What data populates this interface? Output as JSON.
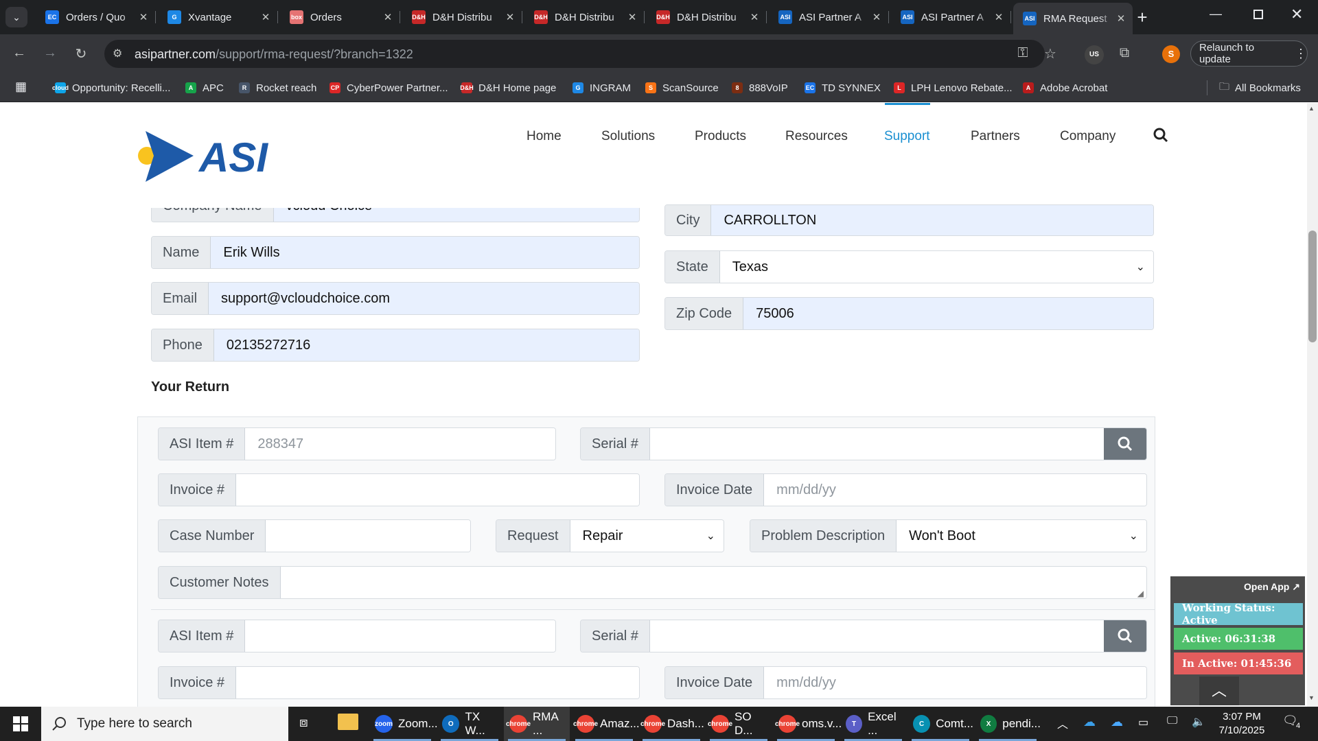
{
  "browser": {
    "tabs": [
      {
        "title": "Orders / Quo",
        "favicon": "EC",
        "color": "#1a73e8"
      },
      {
        "title": "Xvantage",
        "favicon": "G",
        "color": "#1e88e5"
      },
      {
        "title": "Orders",
        "favicon": "box",
        "color": "#e57373"
      },
      {
        "title": "D&H Distribu",
        "favicon": "D&H",
        "color": "#c62828"
      },
      {
        "title": "D&H Distribu",
        "favicon": "D&H",
        "color": "#c62828"
      },
      {
        "title": "D&H Distribu",
        "favicon": "D&H",
        "color": "#c62828"
      },
      {
        "title": "ASI Partner A",
        "favicon": "ASI",
        "color": "#1565c0"
      },
      {
        "title": "ASI Partner A",
        "favicon": "ASI",
        "color": "#1565c0"
      },
      {
        "title": "RMA Request",
        "favicon": "ASI",
        "color": "#1565c0",
        "active": true
      }
    ],
    "url_domain": "asipartner.com",
    "url_path": "/support/rma-request/?branch=1322",
    "relaunch_label": "Relaunch to update",
    "profile_initial": "S",
    "bookmarks": [
      {
        "label": "Opportunity: Recelli...",
        "icon": "cloud",
        "color": "#0ea5e9"
      },
      {
        "label": "APC",
        "icon": "A",
        "color": "#16a34a"
      },
      {
        "label": "Rocket reach",
        "icon": "R",
        "color": "#475569"
      },
      {
        "label": "CyberPower Partner...",
        "icon": "CP",
        "color": "#dc2626"
      },
      {
        "label": "D&H Home page",
        "icon": "D&H",
        "color": "#c62828"
      },
      {
        "label": "INGRAM",
        "icon": "G",
        "color": "#1e88e5"
      },
      {
        "label": "ScanSource",
        "icon": "S",
        "color": "#f97316"
      },
      {
        "label": "888VoIP",
        "icon": "8",
        "color": "#7c2d12"
      },
      {
        "label": "TD SYNNEX",
        "icon": "EC",
        "color": "#1a73e8"
      },
      {
        "label": "LPH Lenovo Rebate...",
        "icon": "L",
        "color": "#dc2626"
      },
      {
        "label": "Adobe Acrobat",
        "icon": "A",
        "color": "#b91c1c"
      }
    ],
    "all_bookmarks_label": "All Bookmarks"
  },
  "site": {
    "logo_text": "ASI",
    "nav": [
      "Home",
      "Solutions",
      "Products",
      "Resources",
      "Support",
      "Partners",
      "Company"
    ],
    "active_nav": "Support"
  },
  "form": {
    "company_label": "Company Name",
    "company_value": "vcloud Choice",
    "name_label": "Name",
    "name_value": "Erik Wills",
    "email_label": "Email",
    "email_value": "support@vcloudchoice.com",
    "phone_label": "Phone",
    "phone_value": "02135272716",
    "city_label": "City",
    "city_value": "CARROLLTON",
    "state_label": "State",
    "state_value": "Texas",
    "zip_label": "Zip Code",
    "zip_value": "75006",
    "section_title": "Your Return",
    "items": [
      {
        "asi_item_label": "ASI Item #",
        "asi_item_placeholder": "288347",
        "serial_label": "Serial #",
        "invoice_label": "Invoice #",
        "invoice_date_label": "Invoice Date",
        "invoice_date_placeholder": "mm/dd/yy",
        "case_label": "Case Number",
        "request_label": "Request",
        "request_value": "Repair",
        "problem_label": "Problem Description",
        "problem_value": "Won't Boot",
        "notes_label": "Customer Notes"
      },
      {
        "asi_item_label": "ASI Item #",
        "serial_label": "Serial #",
        "invoice_label": "Invoice #",
        "invoice_date_label": "Invoice Date",
        "invoice_date_placeholder": "mm/dd/yy"
      }
    ]
  },
  "widget": {
    "open_app": "Open App ↗",
    "status": "Working Status: Active",
    "active": "Active: 06:31:38",
    "inactive": "In Active: 01:45:36"
  },
  "taskbar": {
    "search_placeholder": "Type here to search",
    "apps": [
      {
        "label": "Zoom...",
        "color": "#2563eb",
        "icon": "zoom",
        "active": false
      },
      {
        "label": "TX W...",
        "color": "#0f6cbd",
        "icon": "O",
        "active": false
      },
      {
        "label": "RMA ...",
        "color": "#ea4335",
        "icon": "chrome",
        "active": true
      },
      {
        "label": "Amaz...",
        "color": "#ea4335",
        "icon": "chrome",
        "active": false
      },
      {
        "label": "Dash...",
        "color": "#ea4335",
        "icon": "chrome",
        "active": false
      },
      {
        "label": "SO D...",
        "color": "#ea4335",
        "icon": "chrome",
        "active": false
      },
      {
        "label": "oms.v...",
        "color": "#ea4335",
        "icon": "chrome",
        "active": false
      },
      {
        "label": "Excel ...",
        "color": "#5b5fc7",
        "icon": "T",
        "active": false
      },
      {
        "label": "Comt...",
        "color": "#0891b2",
        "icon": "C",
        "active": false
      },
      {
        "label": "pendi...",
        "color": "#107c41",
        "icon": "X",
        "active": false
      }
    ],
    "time": "3:07 PM",
    "date": "7/10/2025",
    "notifications": "4"
  }
}
